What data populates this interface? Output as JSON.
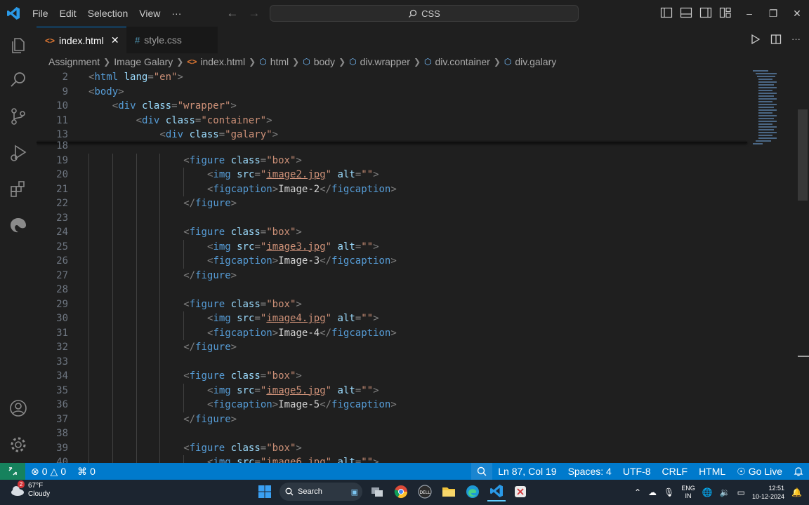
{
  "menu": [
    "File",
    "Edit",
    "Selection",
    "View",
    "···"
  ],
  "command_center": {
    "label": "CSS",
    "icon": "search-icon"
  },
  "tabs": [
    {
      "label": "index.html",
      "icon": "html-file-icon",
      "active": true
    },
    {
      "label": "style.css",
      "icon": "css-file-icon",
      "active": false
    }
  ],
  "breadcrumb": [
    "Assignment",
    "Image Galary",
    "index.html",
    "html",
    "body",
    "div.wrapper",
    "div.container",
    "div.galary"
  ],
  "sticky_lines": [
    {
      "n": "2",
      "indent": 0,
      "tokens": [
        [
          "p",
          "<"
        ],
        [
          "t",
          "html"
        ],
        [
          "s",
          " "
        ],
        [
          "a",
          "lang"
        ],
        [
          "p",
          "="
        ],
        [
          "x",
          "\"en\""
        ],
        [
          "p",
          ">"
        ]
      ]
    },
    {
      "n": "9",
      "indent": 0,
      "tokens": [
        [
          "p",
          "<"
        ],
        [
          "t",
          "body"
        ],
        [
          "p",
          ">"
        ]
      ]
    },
    {
      "n": "10",
      "indent": 1,
      "tokens": [
        [
          "p",
          "<"
        ],
        [
          "t",
          "div"
        ],
        [
          "s",
          " "
        ],
        [
          "a",
          "class"
        ],
        [
          "p",
          "="
        ],
        [
          "x",
          "\"wrapper\""
        ],
        [
          "p",
          ">"
        ]
      ]
    },
    {
      "n": "11",
      "indent": 2,
      "tokens": [
        [
          "p",
          "<"
        ],
        [
          "t",
          "div"
        ],
        [
          "s",
          " "
        ],
        [
          "a",
          "class"
        ],
        [
          "p",
          "="
        ],
        [
          "x",
          "\"container\""
        ],
        [
          "p",
          ">"
        ]
      ]
    },
    {
      "n": "13",
      "indent": 3,
      "tokens": [
        [
          "p",
          "<"
        ],
        [
          "t",
          "div"
        ],
        [
          "s",
          " "
        ],
        [
          "a",
          "class"
        ],
        [
          "p",
          "="
        ],
        [
          "x",
          "\"galary\""
        ],
        [
          "p",
          ">"
        ]
      ]
    }
  ],
  "code_lines": [
    {
      "n": "18",
      "indent": 0,
      "tokens": []
    },
    {
      "n": "19",
      "indent": 4,
      "tokens": [
        [
          "p",
          "<"
        ],
        [
          "t",
          "figure"
        ],
        [
          "s",
          " "
        ],
        [
          "a",
          "class"
        ],
        [
          "p",
          "="
        ],
        [
          "x",
          "\"box\""
        ],
        [
          "p",
          ">"
        ]
      ]
    },
    {
      "n": "20",
      "indent": 5,
      "tokens": [
        [
          "p",
          "<"
        ],
        [
          "t",
          "img"
        ],
        [
          "s",
          " "
        ],
        [
          "a",
          "src"
        ],
        [
          "p",
          "="
        ],
        [
          "x",
          "\""
        ],
        [
          "l",
          "image2.jpg"
        ],
        [
          "x",
          "\""
        ],
        [
          "s",
          " "
        ],
        [
          "a",
          "alt"
        ],
        [
          "p",
          "="
        ],
        [
          "x",
          "\"\""
        ],
        [
          "p",
          ">"
        ]
      ]
    },
    {
      "n": "21",
      "indent": 5,
      "tokens": [
        [
          "p",
          "<"
        ],
        [
          "t",
          "figcaption"
        ],
        [
          "p",
          ">"
        ],
        [
          "w",
          "Image-2"
        ],
        [
          "p",
          "</"
        ],
        [
          "t",
          "figcaption"
        ],
        [
          "p",
          ">"
        ]
      ]
    },
    {
      "n": "22",
      "indent": 4,
      "tokens": [
        [
          "p",
          "</"
        ],
        [
          "t",
          "figure"
        ],
        [
          "p",
          ">"
        ]
      ]
    },
    {
      "n": "23",
      "indent": 0,
      "tokens": []
    },
    {
      "n": "24",
      "indent": 4,
      "tokens": [
        [
          "p",
          "<"
        ],
        [
          "t",
          "figure"
        ],
        [
          "s",
          " "
        ],
        [
          "a",
          "class"
        ],
        [
          "p",
          "="
        ],
        [
          "x",
          "\"box\""
        ],
        [
          "p",
          ">"
        ]
      ]
    },
    {
      "n": "25",
      "indent": 5,
      "tokens": [
        [
          "p",
          "<"
        ],
        [
          "t",
          "img"
        ],
        [
          "s",
          " "
        ],
        [
          "a",
          "src"
        ],
        [
          "p",
          "="
        ],
        [
          "x",
          "\""
        ],
        [
          "l",
          "image3.jpg"
        ],
        [
          "x",
          "\""
        ],
        [
          "s",
          " "
        ],
        [
          "a",
          "alt"
        ],
        [
          "p",
          "="
        ],
        [
          "x",
          "\"\""
        ],
        [
          "p",
          ">"
        ]
      ]
    },
    {
      "n": "26",
      "indent": 5,
      "tokens": [
        [
          "p",
          "<"
        ],
        [
          "t",
          "figcaption"
        ],
        [
          "p",
          ">"
        ],
        [
          "w",
          "Image-3"
        ],
        [
          "p",
          "</"
        ],
        [
          "t",
          "figcaption"
        ],
        [
          "p",
          ">"
        ]
      ]
    },
    {
      "n": "27",
      "indent": 4,
      "tokens": [
        [
          "p",
          "</"
        ],
        [
          "t",
          "figure"
        ],
        [
          "p",
          ">"
        ]
      ]
    },
    {
      "n": "28",
      "indent": 0,
      "tokens": []
    },
    {
      "n": "29",
      "indent": 4,
      "tokens": [
        [
          "p",
          "<"
        ],
        [
          "t",
          "figure"
        ],
        [
          "s",
          " "
        ],
        [
          "a",
          "class"
        ],
        [
          "p",
          "="
        ],
        [
          "x",
          "\"box\""
        ],
        [
          "p",
          ">"
        ]
      ]
    },
    {
      "n": "30",
      "indent": 5,
      "tokens": [
        [
          "p",
          "<"
        ],
        [
          "t",
          "img"
        ],
        [
          "s",
          " "
        ],
        [
          "a",
          "src"
        ],
        [
          "p",
          "="
        ],
        [
          "x",
          "\""
        ],
        [
          "l",
          "image4.jpg"
        ],
        [
          "x",
          "\""
        ],
        [
          "s",
          " "
        ],
        [
          "a",
          "alt"
        ],
        [
          "p",
          "="
        ],
        [
          "x",
          "\"\""
        ],
        [
          "p",
          ">"
        ]
      ]
    },
    {
      "n": "31",
      "indent": 5,
      "tokens": [
        [
          "p",
          "<"
        ],
        [
          "t",
          "figcaption"
        ],
        [
          "p",
          ">"
        ],
        [
          "w",
          "Image-4"
        ],
        [
          "p",
          "</"
        ],
        [
          "t",
          "figcaption"
        ],
        [
          "p",
          ">"
        ]
      ]
    },
    {
      "n": "32",
      "indent": 4,
      "tokens": [
        [
          "p",
          "</"
        ],
        [
          "t",
          "figure"
        ],
        [
          "p",
          ">"
        ]
      ]
    },
    {
      "n": "33",
      "indent": 0,
      "tokens": []
    },
    {
      "n": "34",
      "indent": 4,
      "tokens": [
        [
          "p",
          "<"
        ],
        [
          "t",
          "figure"
        ],
        [
          "s",
          " "
        ],
        [
          "a",
          "class"
        ],
        [
          "p",
          "="
        ],
        [
          "x",
          "\"box\""
        ],
        [
          "p",
          ">"
        ]
      ]
    },
    {
      "n": "35",
      "indent": 5,
      "tokens": [
        [
          "p",
          "<"
        ],
        [
          "t",
          "img"
        ],
        [
          "s",
          " "
        ],
        [
          "a",
          "src"
        ],
        [
          "p",
          "="
        ],
        [
          "x",
          "\""
        ],
        [
          "l",
          "image5.jpg"
        ],
        [
          "x",
          "\""
        ],
        [
          "s",
          " "
        ],
        [
          "a",
          "alt"
        ],
        [
          "p",
          "="
        ],
        [
          "x",
          "\"\""
        ],
        [
          "p",
          ">"
        ]
      ]
    },
    {
      "n": "36",
      "indent": 5,
      "tokens": [
        [
          "p",
          "<"
        ],
        [
          "t",
          "figcaption"
        ],
        [
          "p",
          ">"
        ],
        [
          "w",
          "Image-5"
        ],
        [
          "p",
          "</"
        ],
        [
          "t",
          "figcaption"
        ],
        [
          "p",
          ">"
        ]
      ]
    },
    {
      "n": "37",
      "indent": 4,
      "tokens": [
        [
          "p",
          "</"
        ],
        [
          "t",
          "figure"
        ],
        [
          "p",
          ">"
        ]
      ]
    },
    {
      "n": "38",
      "indent": 0,
      "tokens": []
    },
    {
      "n": "39",
      "indent": 4,
      "tokens": [
        [
          "p",
          "<"
        ],
        [
          "t",
          "figure"
        ],
        [
          "s",
          " "
        ],
        [
          "a",
          "class"
        ],
        [
          "p",
          "="
        ],
        [
          "x",
          "\"box\""
        ],
        [
          "p",
          ">"
        ]
      ]
    },
    {
      "n": "40",
      "indent": 5,
      "tokens": [
        [
          "p",
          "<"
        ],
        [
          "t",
          "img"
        ],
        [
          "s",
          " "
        ],
        [
          "a",
          "src"
        ],
        [
          "p",
          "="
        ],
        [
          "x",
          "\""
        ],
        [
          "l",
          "image6.jpg"
        ],
        [
          "x",
          "\""
        ],
        [
          "s",
          " "
        ],
        [
          "a",
          "alt"
        ],
        [
          "p",
          "="
        ],
        [
          "x",
          "\"\""
        ],
        [
          "p",
          ">"
        ]
      ]
    }
  ],
  "statusbar": {
    "errors": "0",
    "warnings": "0",
    "ports": "0",
    "position": "Ln 87, Col 19",
    "spaces": "Spaces: 4",
    "encoding": "UTF-8",
    "eol": "CRLF",
    "language": "HTML",
    "golive": "Go Live"
  },
  "taskbar": {
    "weather_temp": "67°F",
    "weather_desc": "Cloudy",
    "weather_badge": "2",
    "search_label": "Search",
    "lang_top": "ENG",
    "lang_bottom": "IN",
    "time": "12:51",
    "date": "10-12-2024"
  },
  "colors": {
    "accent": "#007acc",
    "tag": "#569cd6",
    "attr": "#9cdcfe",
    "string": "#ce9178"
  }
}
